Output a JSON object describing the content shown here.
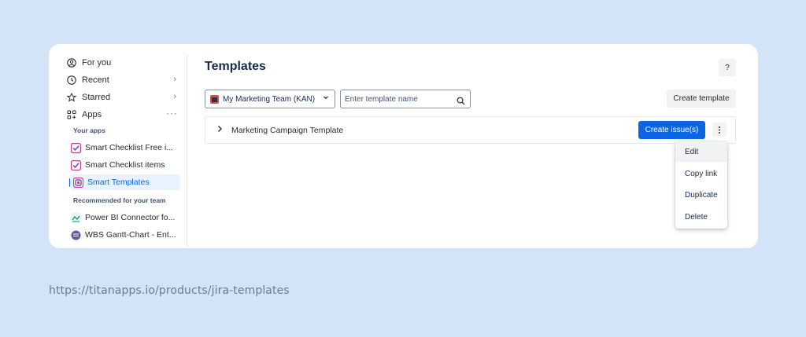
{
  "sidebar": {
    "nav": [
      {
        "label": "For you",
        "icon": "user-circle-icon"
      },
      {
        "label": "Recent",
        "icon": "clock-icon"
      },
      {
        "label": "Starred",
        "icon": "star-icon"
      },
      {
        "label": "Apps",
        "icon": "apps-grid-icon"
      }
    ],
    "your_apps_label": "Your apps",
    "apps": [
      {
        "label": "Smart Checklist Free i..."
      },
      {
        "label": "Smart Checklist items"
      },
      {
        "label": "Smart Templates"
      }
    ],
    "recommended_label": "Recommended for your team",
    "recommended": [
      {
        "label": "Power BI Connector fo..."
      },
      {
        "label": "WBS Gantt-Chart - Ent..."
      }
    ]
  },
  "main": {
    "title": "Templates",
    "help_label": "?",
    "project_select": "My Marketing Team (KAN)",
    "search_placeholder": "Enter template name",
    "create_template_label": "Create template",
    "templates": [
      {
        "name": "Marketing Campaign Template",
        "action_label": "Create issue(s)"
      }
    ],
    "menu": [
      "Edit",
      "Copy link",
      "Duplicate",
      "Delete"
    ]
  },
  "footer": {
    "url": "https://titanapps.io/products/jira-templates"
  },
  "colors": {
    "background": "#d3e3f8",
    "primary": "#0c66e4",
    "card": "#ffffff"
  }
}
